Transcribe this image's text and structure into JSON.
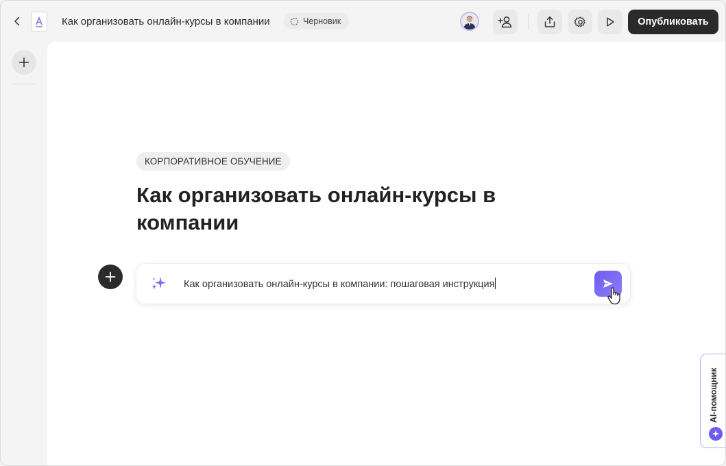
{
  "header": {
    "document_title": "Как организовать онлайн-курсы в компании",
    "status": "Черновик",
    "publish_label": "Опубликовать",
    "icons": {
      "back": "chevron-left-icon",
      "document": "document-icon",
      "status": "draft-circle-icon",
      "invite": "add-user-icon",
      "share": "upload-icon",
      "settings": "gear-icon",
      "preview": "play-icon"
    }
  },
  "editor": {
    "category_tag": "КОРПОРАТИВНОЕ ОБУЧЕНИЕ",
    "headline": "Как организовать онлайн-курсы в компании",
    "ai_prompt": {
      "value": "Как организовать онлайн-курсы в компании: пошаговая инструкция",
      "icon": "sparkle-icon",
      "send_icon": "send-icon"
    }
  },
  "sidebar_tab": {
    "label": "AI-помощник",
    "icon": "ai-star-icon"
  },
  "colors": {
    "accent": "#6d5cf0",
    "dark": "#2a2a2a",
    "canvas": "#ffffff",
    "background": "#f4f4f4"
  }
}
